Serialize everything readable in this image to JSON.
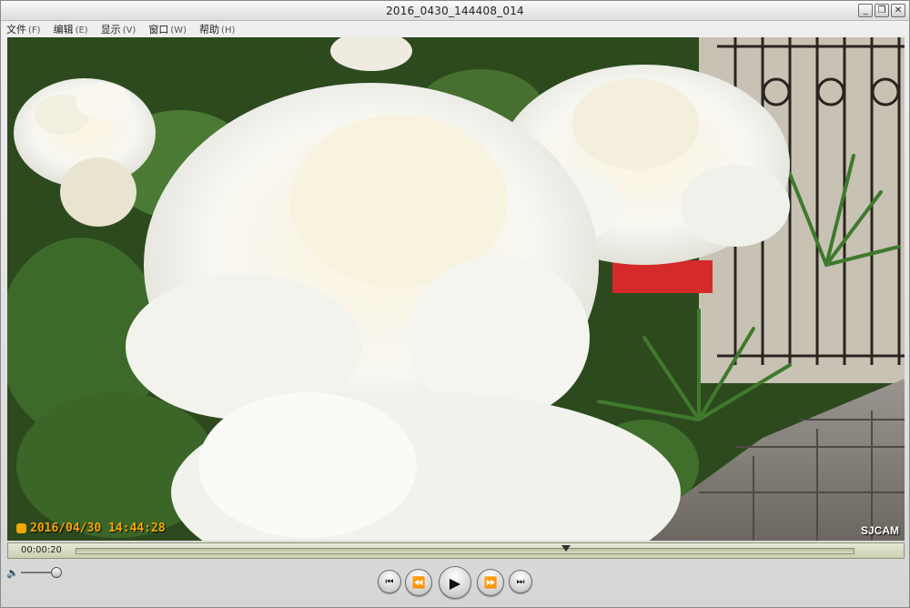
{
  "window": {
    "title": "2016_0430_144408_014",
    "minimize_glyph": "_",
    "restore_glyph": "❐",
    "close_glyph": "✕"
  },
  "menu": [
    {
      "label": "文件",
      "key": "(F)"
    },
    {
      "label": "编辑",
      "key": "(E)"
    },
    {
      "label": "显示",
      "key": "(V)"
    },
    {
      "label": "窗口",
      "key": "(W)"
    },
    {
      "label": "帮助",
      "key": "(H)"
    }
  ],
  "video": {
    "timestamp": "2016/04/30 14:44:28",
    "watermark": "SJCAM"
  },
  "playback": {
    "elapsed": "00:00:20",
    "progress": 0.63
  },
  "icons": {
    "volume": "🔈",
    "skip_back": "⏮",
    "rewind": "⏪",
    "play": "▶",
    "fast_forward": "⏩",
    "skip_forward": "⏭"
  },
  "colors": {
    "timestamp": "#f6a800",
    "seekbar": "#d6dcc2"
  }
}
